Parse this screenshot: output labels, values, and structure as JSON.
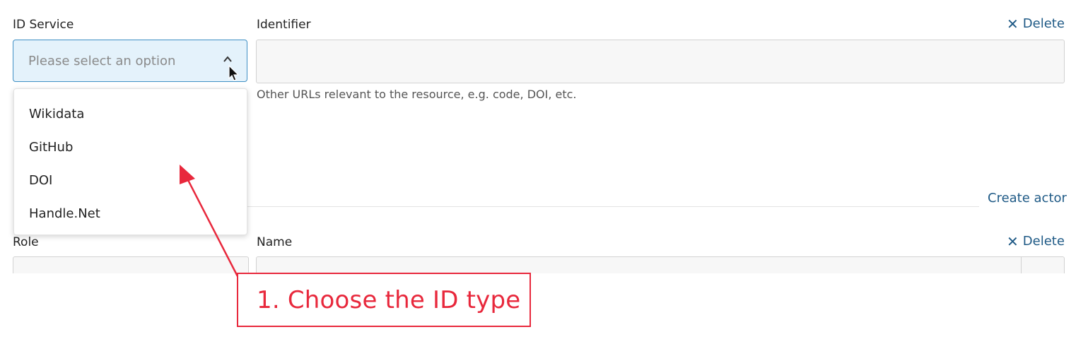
{
  "form": {
    "id_service_label": "ID Service",
    "identifier_label": "Identifier",
    "delete_label": "Delete",
    "select_placeholder": "Please select an option",
    "identifier_value": "",
    "identifier_help": "Other URLs relevant to the resource, e.g. code, DOI, etc.",
    "create_actor_label": "Create actor",
    "role_label": "Role",
    "name_label": "Name"
  },
  "dropdown": {
    "options": [
      "Wikidata",
      "GitHub",
      "DOI",
      "Handle.Net"
    ]
  },
  "annotation": {
    "callout_text": "1. Choose the ID type",
    "color": "#e8283c"
  },
  "colors": {
    "link": "#1f5a86",
    "select_border": "#3f8fc4",
    "select_bg": "#e4f2fb"
  }
}
